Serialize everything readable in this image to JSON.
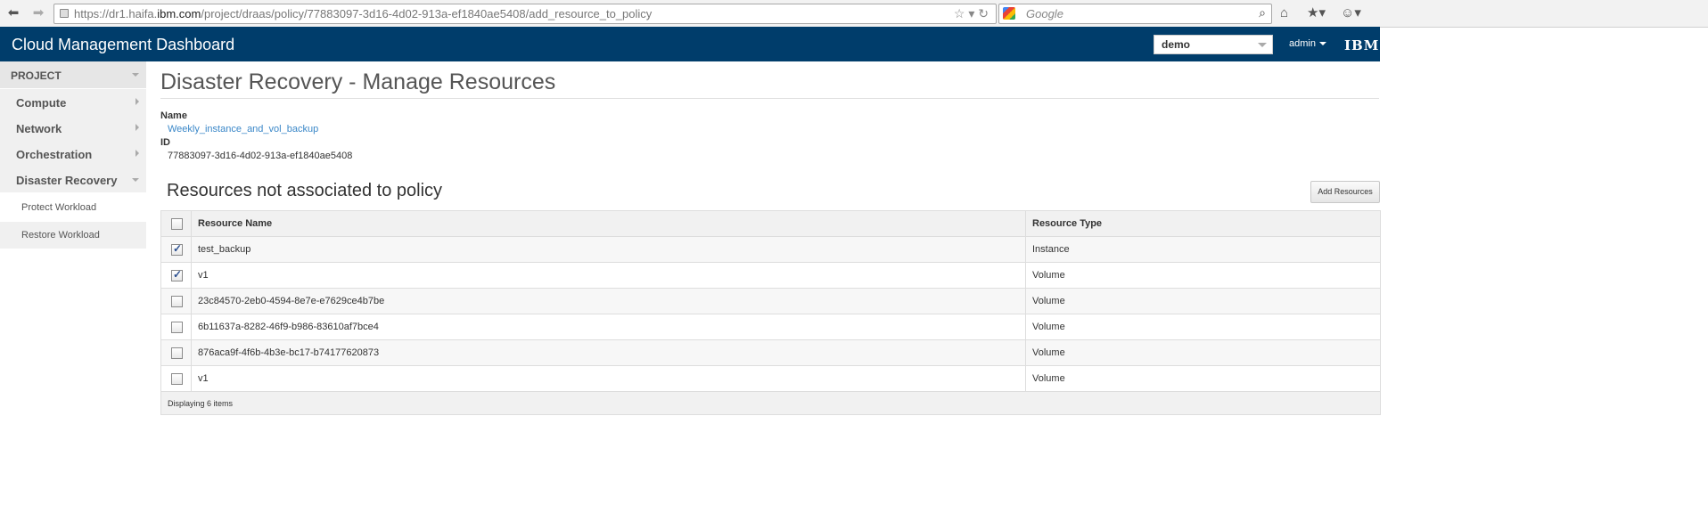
{
  "browser": {
    "url_prefix": "https://dr1.haifa.",
    "url_domain": "ibm.com",
    "url_path": "/project/draas/policy/77883097-3d16-4d02-913a-ef1840ae5408/add_resource_to_policy",
    "search_placeholder": "Google",
    "icons": [
      "back-arrow-icon",
      "forward-arrow-icon",
      "lock-icon",
      "bookmark-star-icon",
      "reload-icon",
      "google-icon",
      "search-icon",
      "home-icon",
      "bookmarks-icon",
      "addon-icon"
    ]
  },
  "header": {
    "brand": "Cloud Management Dashboard",
    "project": "demo",
    "user": "admin",
    "logo": "IBM.",
    "bg_color": "#003d6b"
  },
  "sidebar": {
    "section": "PROJECT",
    "items": [
      {
        "label": "Compute"
      },
      {
        "label": "Network"
      },
      {
        "label": "Orchestration"
      },
      {
        "label": "Disaster Recovery"
      }
    ],
    "subitems": [
      {
        "label": "Protect Workload"
      },
      {
        "label": "Restore Workload"
      }
    ]
  },
  "main": {
    "title": "Disaster Recovery - Manage Resources",
    "name_label": "Name",
    "name_value": "Weekly_instance_and_vol_backup",
    "id_label": "ID",
    "id_value": "77883097-3d16-4d02-913a-ef1840ae5408",
    "section_title": "Resources not associated to policy",
    "add_button": "Add Resources",
    "table": {
      "headers": [
        "Resource Name",
        "Resource Type"
      ],
      "rows": [
        {
          "name": "test_backup",
          "type": "Instance",
          "checked": true
        },
        {
          "name": "v1",
          "type": "Volume",
          "checked": true
        },
        {
          "name": "23c84570-2eb0-4594-8e7e-e7629ce4b7be",
          "type": "Volume",
          "checked": false
        },
        {
          "name": "6b11637a-8282-46f9-b986-83610af7bce4",
          "type": "Volume",
          "checked": false
        },
        {
          "name": "876aca9f-4f6b-4b3e-bc17-b74177620873",
          "type": "Volume",
          "checked": false
        },
        {
          "name": "v1",
          "type": "Volume",
          "checked": false
        }
      ],
      "footer": "Displaying 6 items"
    }
  }
}
